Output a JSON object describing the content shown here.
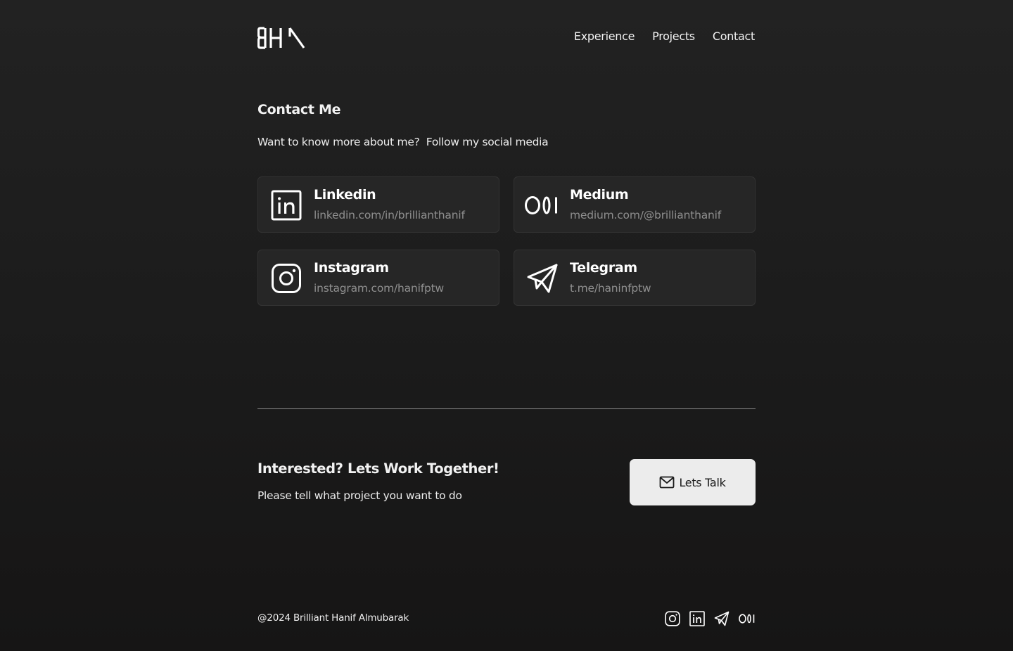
{
  "header": {
    "logo_icon": "bha-monogram-logo",
    "nav": [
      {
        "label": "Experience"
      },
      {
        "label": "Projects"
      },
      {
        "label": "Contact"
      }
    ]
  },
  "contact": {
    "title": "Contact Me",
    "subtitle": "Want to know more about me?  Follow my social media",
    "cards": [
      {
        "name": "Linkedin",
        "url": "linkedin.com/in/brillianthanif",
        "icon": "linkedin-icon"
      },
      {
        "name": "Medium",
        "url": "medium.com/@brillianthanif",
        "icon": "medium-icon"
      },
      {
        "name": "Instagram",
        "url": "instagram.com/hanifptw",
        "icon": "instagram-icon"
      },
      {
        "name": "Telegram",
        "url": "t.me/haninfptw",
        "icon": "telegram-icon"
      }
    ]
  },
  "cta": {
    "title": "Interested? Lets Work Together!",
    "subtitle": "Please tell what project you want to do",
    "button_label": "Lets Talk",
    "button_icon": "mail-icon"
  },
  "footer": {
    "copyright": "@2024 Brilliant Hanif Almubarak",
    "icons": [
      "instagram-icon",
      "linkedin-icon",
      "telegram-icon",
      "medium-icon"
    ]
  },
  "colors": {
    "background": "#1b1b1b",
    "card": "#262626",
    "card_border": "#333333",
    "muted_text": "#8f8f8f",
    "button_bg": "#ececec"
  }
}
